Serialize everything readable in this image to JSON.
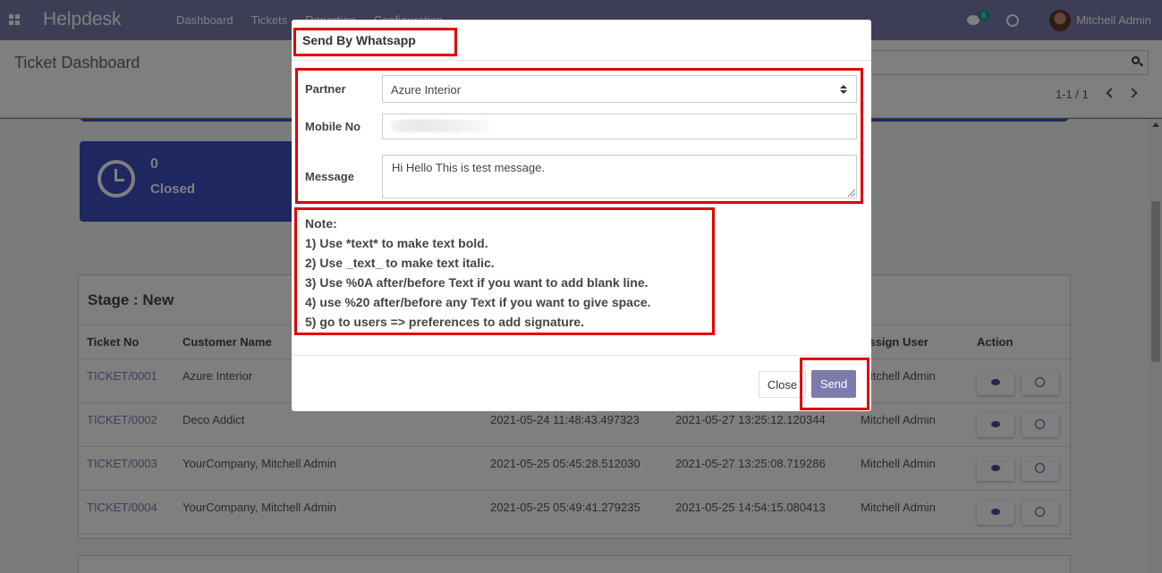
{
  "navbar": {
    "brand": "Helpdesk",
    "menu": [
      "Dashboard",
      "Tickets",
      "Reporting",
      "Configuration"
    ],
    "chat_count": "6",
    "user_name": "Mitchell Admin"
  },
  "control_panel": {
    "title": "Ticket Dashboard",
    "pager": "1-1 / 1"
  },
  "stat_card": {
    "count": "0",
    "label": "Closed"
  },
  "stage": {
    "title": "Stage : New",
    "columns": [
      "Ticket No",
      "Customer Name",
      "",
      "",
      "Assign User",
      "Action"
    ],
    "rows": [
      {
        "ticket": "TICKET/0001",
        "customer": "Azure Interior",
        "created": "",
        "updated": "",
        "user": "Mitchell Admin"
      },
      {
        "ticket": "TICKET/0002",
        "customer": "Deco Addict",
        "created": "2021-05-24 11:48:43.497323",
        "updated": "2021-05-27 13:25:12.120344",
        "user": "Mitchell Admin"
      },
      {
        "ticket": "TICKET/0003",
        "customer": "YourCompany, Mitchell Admin",
        "created": "2021-05-25 05:45:28.512030",
        "updated": "2021-05-27 13:25:08.719286",
        "user": "Mitchell Admin"
      },
      {
        "ticket": "TICKET/0004",
        "customer": "YourCompany, Mitchell Admin",
        "created": "2021-05-25 05:49:41.279235",
        "updated": "2021-05-25 14:54:15.080413",
        "user": "Mitchell Admin"
      }
    ]
  },
  "modal": {
    "title": "Send By Whatsapp",
    "partner_label": "Partner",
    "partner_value": "Azure Interior",
    "mobile_label": "Mobile No",
    "message_label": "Message",
    "message_value": "Hi Hello This is test message.",
    "note": [
      "Note:",
      "1) Use *text* to make text bold.",
      "2) Use _text_ to make text italic.",
      "3) Use %0A after/before Text if you want to add blank line.",
      "4) use %20 after/before any Text if you want to give space.",
      "5) go to users => preferences to add signature."
    ],
    "close_label": "Close",
    "send_label": "Send",
    "highlight_color": "#e00000",
    "accent_color": "#7c7bad"
  }
}
